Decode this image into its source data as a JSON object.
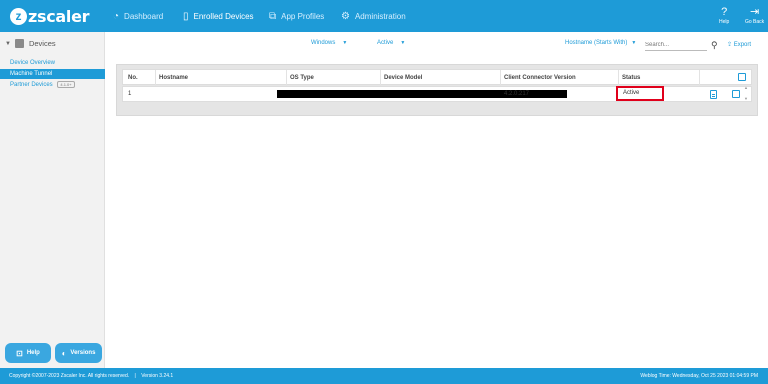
{
  "brand": {
    "name": "zscaler",
    "primary_color": "#1e9bd7",
    "highlight_color": "#e0001b"
  },
  "topnav": {
    "items": [
      {
        "label": "Dashboard",
        "icon": "dashboard-icon"
      },
      {
        "label": "Enrolled Devices",
        "icon": "device-icon"
      },
      {
        "label": "App Profiles",
        "icon": "sitemap-icon"
      },
      {
        "label": "Administration",
        "icon": "gears-icon"
      }
    ],
    "help_label": "Help",
    "goback_label": "Go Back"
  },
  "sidebar": {
    "header": "Devices",
    "links": [
      {
        "label": "Device Overview"
      },
      {
        "label": "Machine Tunnel"
      },
      {
        "label": "Partner Devices",
        "badge": "4.1.0+"
      }
    ],
    "help_button": "Help",
    "versions_button": "Versions"
  },
  "filters": {
    "os": "Windows",
    "state": "Active",
    "search_field": "Hostname (Starts With)",
    "search_placeholder": "Search...",
    "export_label": "Export"
  },
  "table": {
    "columns": [
      "No.",
      "Hostname",
      "OS Type",
      "Device Model",
      "Client Connector Version",
      "Status"
    ],
    "rows": [
      {
        "no": "1",
        "version": "4.2.0.217",
        "status": "Active"
      }
    ]
  },
  "footer": {
    "copyright": "Copyright ©2007-2023 Zscaler Inc. All rights reserved.",
    "version": "Version 3.24.1",
    "time": "Weblog Time: Wednesday, Oct 25 2023 01:04:59 PM"
  }
}
